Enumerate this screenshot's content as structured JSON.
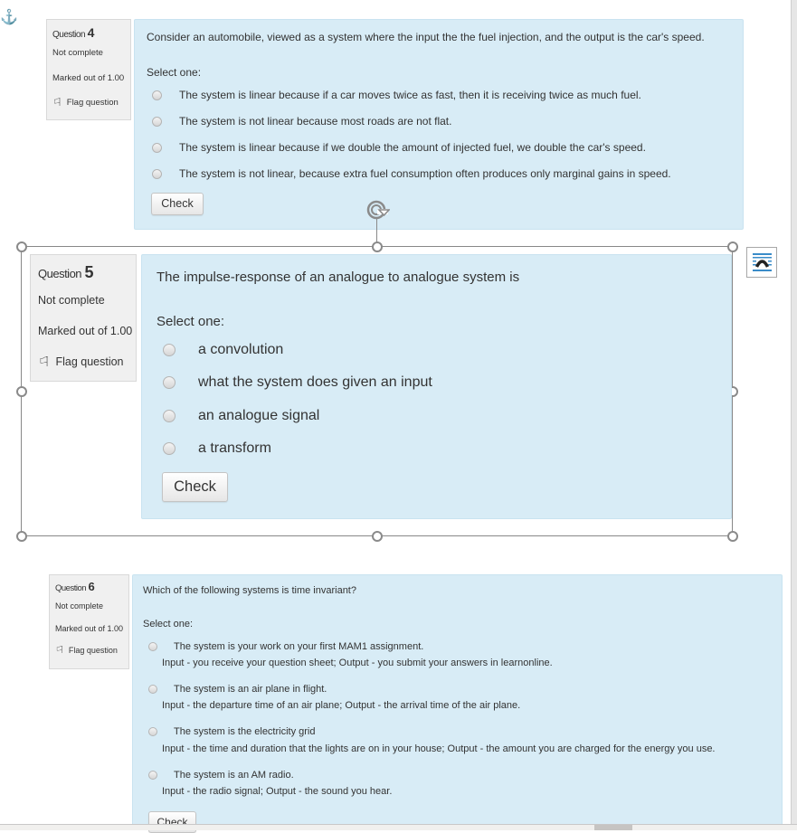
{
  "colors": {
    "content_bg": "#d8ecf6",
    "info_bg": "#f0f0f0",
    "accent": "#3a8cc9",
    "handle": "#8a8a8a"
  },
  "page": {
    "anchor_icon": "anchor-icon",
    "wrap_text_icon": "wrap-text-icon",
    "rotate_icon": "rotate-handle-icon"
  },
  "questions": [
    {
      "label": "Question",
      "number": "4",
      "status": "Not complete",
      "marks": "Marked out of 1.00",
      "flag_label": "Flag question",
      "text": "Consider an automobile, viewed as a system where the input the the fuel injection, and the output is the car's speed.",
      "select_label": "Select one:",
      "options": [
        {
          "text": "The system is linear because if a car moves twice as fast, then it is receiving twice as much fuel."
        },
        {
          "text": "The system is not linear because most roads are not flat."
        },
        {
          "text": "The system is linear because if we double the amount of injected fuel, we double the car's speed."
        },
        {
          "text": "The system is not linear, because extra fuel consumption often produces only marginal gains in speed."
        }
      ],
      "check_label": "Check"
    },
    {
      "label": "Question",
      "number": "5",
      "status": "Not complete",
      "marks": "Marked out of 1.00",
      "flag_label": "Flag question",
      "text": "The impulse-response of an analogue to analogue system is",
      "select_label": "Select one:",
      "options": [
        {
          "text": "a convolution"
        },
        {
          "text": "what the system does given an input"
        },
        {
          "text": "an analogue signal"
        },
        {
          "text": "a transform"
        }
      ],
      "check_label": "Check"
    },
    {
      "label": "Question",
      "number": "6",
      "status": "Not complete",
      "marks": "Marked out of 1.00",
      "flag_label": "Flag question",
      "text": "Which of the following systems is time invariant?",
      "select_label": "Select one:",
      "options": [
        {
          "text": "The system is your work on your first MAM1 assignment.",
          "detail": "Input - you receive your question sheet; Output - you submit your answers in learnonline."
        },
        {
          "text": "The system is an air plane in flight.",
          "detail": "Input - the departure time of an air plane; Output - the arrival time of the air plane."
        },
        {
          "text": "The system is the electricity grid",
          "detail": "Input - the time and duration that the lights are on in your house; Output - the amount you are charged for the energy you use."
        },
        {
          "text": "The system is an AM radio.",
          "detail": "Input - the radio signal; Output - the sound you hear."
        }
      ],
      "check_label": "Check"
    }
  ]
}
